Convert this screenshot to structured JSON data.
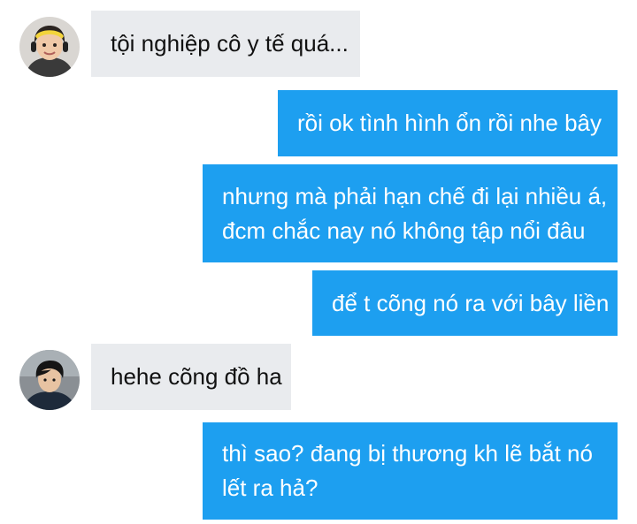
{
  "conversation": {
    "messages": [
      {
        "direction": "incoming",
        "sender_avatar": "avatar-girl-yellow-headband",
        "lines": [
          "tội nghiệp cô y tế quá..."
        ]
      },
      {
        "direction": "outgoing",
        "lines": [
          "rồi ok tình hình ổn rồi nhe bây"
        ]
      },
      {
        "direction": "outgoing",
        "lines": [
          "nhưng mà phải hạn chế đi lại nhiều á,",
          "đcm chắc nay nó không tập nổi đâu"
        ]
      },
      {
        "direction": "outgoing",
        "lines": [
          "để t cõng nó ra với bây liền"
        ]
      },
      {
        "direction": "incoming",
        "sender_avatar": "avatar-boy-dark-hair",
        "lines": [
          "hehe cõng đồ ha"
        ]
      },
      {
        "direction": "outgoing",
        "lines": [
          "thì sao? đang bị thương kh lẽ bắt nó",
          "lết ra hả?"
        ]
      }
    ]
  },
  "colors": {
    "incoming_bubble": "#e9ebee",
    "outgoing_bubble": "#1d9ff0",
    "incoming_text": "#111111",
    "outgoing_text": "#ffffff"
  }
}
